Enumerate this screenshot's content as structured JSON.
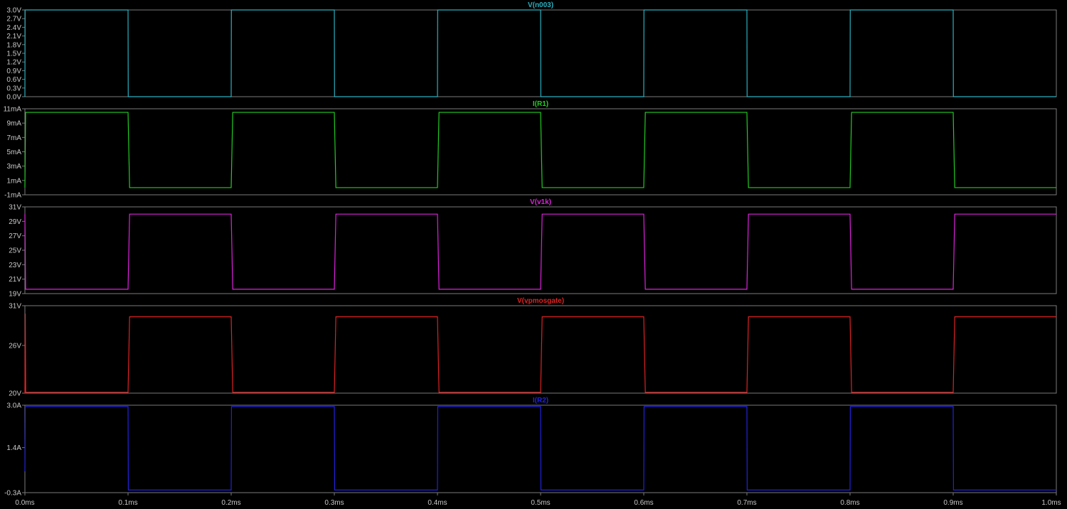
{
  "chart_data": [
    {
      "type": "line",
      "title": "V(n003)",
      "color": "#2ab0c0",
      "ylim": [
        0,
        3.0
      ],
      "yticks": [
        {
          "v": 0.0,
          "label": "0.0V"
        },
        {
          "v": 0.3,
          "label": "0.3V"
        },
        {
          "v": 0.6,
          "label": "0.6V"
        },
        {
          "v": 0.9,
          "label": "0.9V"
        },
        {
          "v": 1.2,
          "label": "1.2V"
        },
        {
          "v": 1.5,
          "label": "1.5V"
        },
        {
          "v": 1.8,
          "label": "1.8V"
        },
        {
          "v": 2.1,
          "label": "2.1V"
        },
        {
          "v": 2.4,
          "label": "2.4V"
        },
        {
          "v": 2.7,
          "label": "2.7V"
        },
        {
          "v": 3.0,
          "label": "3.0V"
        }
      ],
      "x": [
        0,
        0.0002,
        0.1,
        0.1002,
        0.2,
        0.2002,
        0.3,
        0.3002,
        0.4,
        0.4002,
        0.5,
        0.5002,
        0.6,
        0.6002,
        0.7,
        0.7002,
        0.8,
        0.8002,
        0.9,
        0.9002,
        1.0
      ],
      "y": [
        0,
        3.0,
        3.0,
        0,
        0,
        3.0,
        3.0,
        0,
        0,
        3.0,
        3.0,
        0,
        0,
        3.0,
        3.0,
        0,
        0,
        3.0,
        3.0,
        0,
        0
      ]
    },
    {
      "type": "line",
      "title": "I(R1)",
      "color": "#22cc22",
      "ylim": [
        -1,
        11
      ],
      "yticks": [
        {
          "v": -1,
          "label": "-1mA"
        },
        {
          "v": 1,
          "label": "1mA"
        },
        {
          "v": 3,
          "label": "3mA"
        },
        {
          "v": 5,
          "label": "5mA"
        },
        {
          "v": 7,
          "label": "7mA"
        },
        {
          "v": 9,
          "label": "9mA"
        },
        {
          "v": 11,
          "label": "11mA"
        }
      ],
      "x": [
        0,
        0.0007,
        0.1,
        0.1015,
        0.2,
        0.2015,
        0.3,
        0.3015,
        0.4,
        0.4015,
        0.5,
        0.5015,
        0.6,
        0.6015,
        0.7,
        0.7015,
        0.8,
        0.8015,
        0.9,
        0.9015,
        1.0
      ],
      "y": [
        0,
        10.5,
        10.5,
        0.0,
        0.0,
        10.5,
        10.5,
        0.0,
        0.0,
        10.5,
        10.5,
        0.0,
        0.0,
        10.5,
        10.5,
        0.0,
        0.0,
        10.5,
        10.5,
        0.0,
        0.0
      ]
    },
    {
      "type": "line",
      "title": "V(v1k)",
      "color": "#dd22dd",
      "ylim": [
        19,
        31
      ],
      "yticks": [
        {
          "v": 19,
          "label": "19V"
        },
        {
          "v": 21,
          "label": "21V"
        },
        {
          "v": 23,
          "label": "23V"
        },
        {
          "v": 25,
          "label": "25V"
        },
        {
          "v": 27,
          "label": "27V"
        },
        {
          "v": 29,
          "label": "29V"
        },
        {
          "v": 31,
          "label": "31V"
        }
      ],
      "x": [
        0,
        0.0007,
        0.1,
        0.1015,
        0.2,
        0.2015,
        0.3,
        0.3015,
        0.4,
        0.4015,
        0.5,
        0.5015,
        0.6,
        0.6015,
        0.7,
        0.7015,
        0.8,
        0.8015,
        0.9,
        0.9015,
        1.0
      ],
      "y": [
        30.0,
        19.6,
        19.6,
        30.0,
        30.0,
        19.6,
        19.6,
        30.0,
        30.0,
        19.6,
        19.6,
        30.0,
        30.0,
        19.6,
        19.6,
        30.0,
        30.0,
        19.6,
        19.6,
        30.0,
        30.0
      ]
    },
    {
      "type": "line",
      "title": "V(vpmosgate)",
      "color": "#dd2222",
      "ylim": [
        20,
        31
      ],
      "yticks": [
        {
          "v": 20,
          "label": "20V"
        },
        {
          "v": 26,
          "label": "26V"
        },
        {
          "v": 31,
          "label": "31V"
        }
      ],
      "x": [
        0,
        0.0004,
        0.0008,
        0.1,
        0.1015,
        0.2,
        0.2015,
        0.3,
        0.3015,
        0.4,
        0.4015,
        0.5,
        0.5015,
        0.6,
        0.6015,
        0.7,
        0.7015,
        0.8,
        0.8015,
        0.9,
        0.9015,
        1.0
      ],
      "y": [
        20.0,
        30.0,
        20.1,
        20.1,
        29.6,
        29.6,
        20.1,
        20.1,
        29.6,
        29.6,
        20.1,
        20.1,
        29.6,
        29.6,
        20.1,
        20.1,
        29.6,
        29.6,
        20.1,
        20.1,
        29.6,
        29.6
      ]
    },
    {
      "type": "line",
      "title": "I(R2)",
      "color": "#2222dd",
      "ylim": [
        -0.3,
        3.0
      ],
      "yticks": [
        {
          "v": -0.3,
          "label": "-0.3A"
        },
        {
          "v": 1.4,
          "label": "1.4A"
        },
        {
          "v": 3.0,
          "label": "3.0A"
        }
      ],
      "x": [
        0,
        0.0004,
        0.1,
        0.1003,
        0.2,
        0.2003,
        0.3,
        0.3003,
        0.4,
        0.4003,
        0.5,
        0.5003,
        0.6,
        0.6003,
        0.7,
        0.7003,
        0.8,
        0.8003,
        0.9,
        0.9003,
        1.0
      ],
      "y": [
        0.5,
        2.95,
        2.95,
        -0.2,
        -0.2,
        2.95,
        2.95,
        -0.2,
        -0.2,
        2.95,
        2.95,
        -0.2,
        -0.2,
        2.95,
        2.95,
        -0.2,
        -0.2,
        2.95,
        2.95,
        -0.2,
        -0.2
      ]
    }
  ],
  "x_axis": {
    "xlim": [
      0,
      1.0
    ],
    "ticks": [
      {
        "v": 0.0,
        "label": "0.0ms"
      },
      {
        "v": 0.1,
        "label": "0.1ms"
      },
      {
        "v": 0.2,
        "label": "0.2ms"
      },
      {
        "v": 0.3,
        "label": "0.3ms"
      },
      {
        "v": 0.4,
        "label": "0.4ms"
      },
      {
        "v": 0.5,
        "label": "0.5ms"
      },
      {
        "v": 0.6,
        "label": "0.6ms"
      },
      {
        "v": 0.7,
        "label": "0.7ms"
      },
      {
        "v": 0.8,
        "label": "0.8ms"
      },
      {
        "v": 0.9,
        "label": "0.9ms"
      },
      {
        "v": 1.0,
        "label": "1.0ms"
      }
    ]
  }
}
